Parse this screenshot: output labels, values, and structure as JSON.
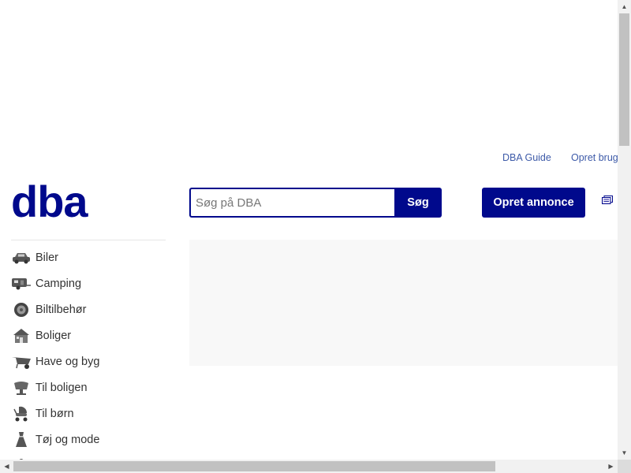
{
  "top_links": [
    {
      "label": "DBA Guide"
    },
    {
      "label": "Opret brug"
    }
  ],
  "logo": {
    "text": "dba"
  },
  "search": {
    "placeholder": "Søg på DBA",
    "value": "",
    "button_label": "Søg"
  },
  "create_ad": {
    "label": "Opret annonce"
  },
  "categories": [
    {
      "label": "Biler",
      "icon": "car-icon"
    },
    {
      "label": "Camping",
      "icon": "caravan-icon"
    },
    {
      "label": "Biltilbehør",
      "icon": "tire-icon"
    },
    {
      "label": "Boliger",
      "icon": "house-icon"
    },
    {
      "label": "Have og byg",
      "icon": "wheelbarrow-icon"
    },
    {
      "label": "Til boligen",
      "icon": "chair-icon"
    },
    {
      "label": "Til børn",
      "icon": "stroller-icon"
    },
    {
      "label": "Tøj og mode",
      "icon": "dress-icon"
    }
  ],
  "colors": {
    "brand": "#00098c",
    "link": "#3d5aa8",
    "icon": "#555555"
  }
}
